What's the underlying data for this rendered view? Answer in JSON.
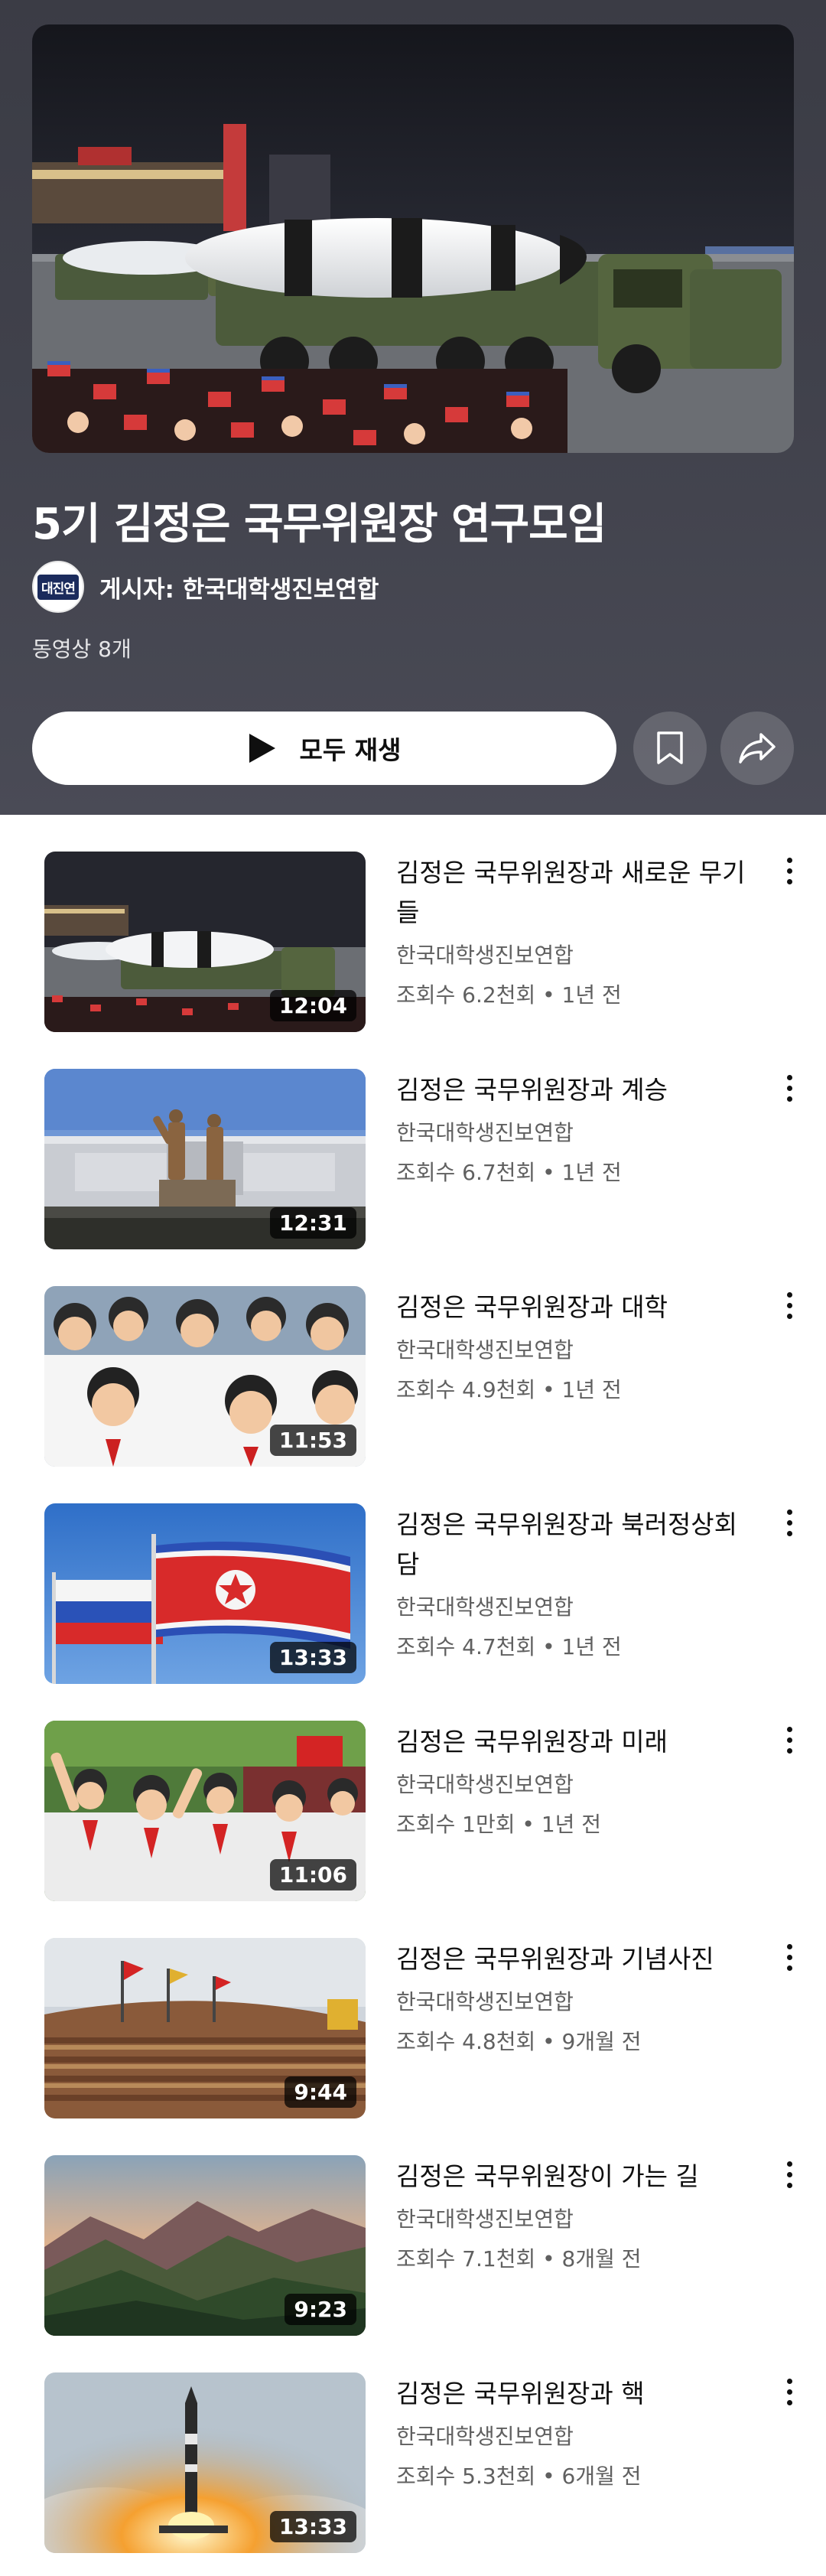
{
  "playlist": {
    "title": "5기 김정은 국무위원장 연구모임",
    "author_prefix": "게시자: ",
    "author": "한국대학생진보연합",
    "avatar_text": "대진연",
    "video_count": "동영상 8개",
    "play_all_label": "모두 재생"
  },
  "icons": {
    "play": "play-icon",
    "save": "bookmark-icon",
    "share": "share-icon",
    "menu": "more-vert-icon"
  },
  "videos": [
    {
      "title": "김정은 국무위원장과 새로운 무기들",
      "channel": "한국대학생진보연합",
      "meta": "조회수 6.2천회 • 1년 전",
      "duration": "12:04",
      "thumb": "missile-parade"
    },
    {
      "title": "김정은 국무위원장과 계승",
      "channel": "한국대학생진보연합",
      "meta": "조회수 6.7천회 • 1년 전",
      "duration": "12:31",
      "thumb": "statues"
    },
    {
      "title": "김정은 국무위원장과 대학",
      "channel": "한국대학생진보연합",
      "meta": "조회수 4.9천회 • 1년 전",
      "duration": "11:53",
      "thumb": "students"
    },
    {
      "title": "김정은 국무위원장과 북러정상회담",
      "channel": "한국대학생진보연합",
      "meta": "조회수 4.7천회 • 1년 전",
      "duration": "13:33",
      "thumb": "flags"
    },
    {
      "title": "김정은 국무위원장과 미래",
      "channel": "한국대학생진보연합",
      "meta": "조회수 1만회 • 1년 전",
      "duration": "11:06",
      "thumb": "children"
    },
    {
      "title": "김정은 국무위원장과 기념사진",
      "channel": "한국대학생진보연합",
      "meta": "조회수 4.8천회 • 9개월 전",
      "duration": "9:44",
      "thumb": "group-photo"
    },
    {
      "title": "김정은 국무위원장이 가는 길",
      "channel": "한국대학생진보연합",
      "meta": "조회수 7.1천회 • 8개월 전",
      "duration": "9:23",
      "thumb": "mountains"
    },
    {
      "title": "김정은 국무위원장과 핵",
      "channel": "한국대학생진보연합",
      "meta": "조회수 5.3천회 • 6개월 전",
      "duration": "13:33",
      "thumb": "rocket-launch"
    }
  ]
}
